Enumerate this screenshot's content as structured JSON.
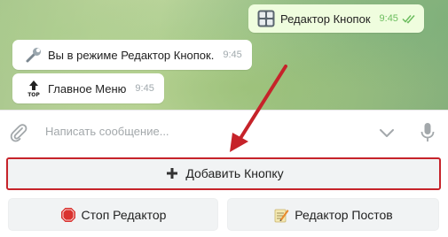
{
  "chat": {
    "messages": [
      {
        "direction": "out",
        "icon": "keycap-grid-icon",
        "text": "Редактор Кнопок",
        "time": "9:45",
        "status": "read"
      },
      {
        "direction": "in",
        "icon": "wrench-icon",
        "text": "Вы в режиме Редактор Кнопок.",
        "time": "9:45"
      },
      {
        "direction": "in",
        "icon": "top-arrow-icon",
        "text": "Главное Меню",
        "time": "9:45"
      }
    ]
  },
  "composer": {
    "placeholder": "Написать сообщение..."
  },
  "keyboard": {
    "add_button": {
      "icon": "plus-icon",
      "label": "Добавить Кнопку"
    },
    "stop_button": {
      "icon": "stop-sign-icon",
      "label": "Стоп Редактор"
    },
    "posts_button": {
      "icon": "memo-icon",
      "label": "Редактор Постов"
    }
  },
  "colors": {
    "highlight": "#c6232a",
    "outgoing_bubble": "#effdde",
    "read_ticks": "#6cbd5f"
  }
}
